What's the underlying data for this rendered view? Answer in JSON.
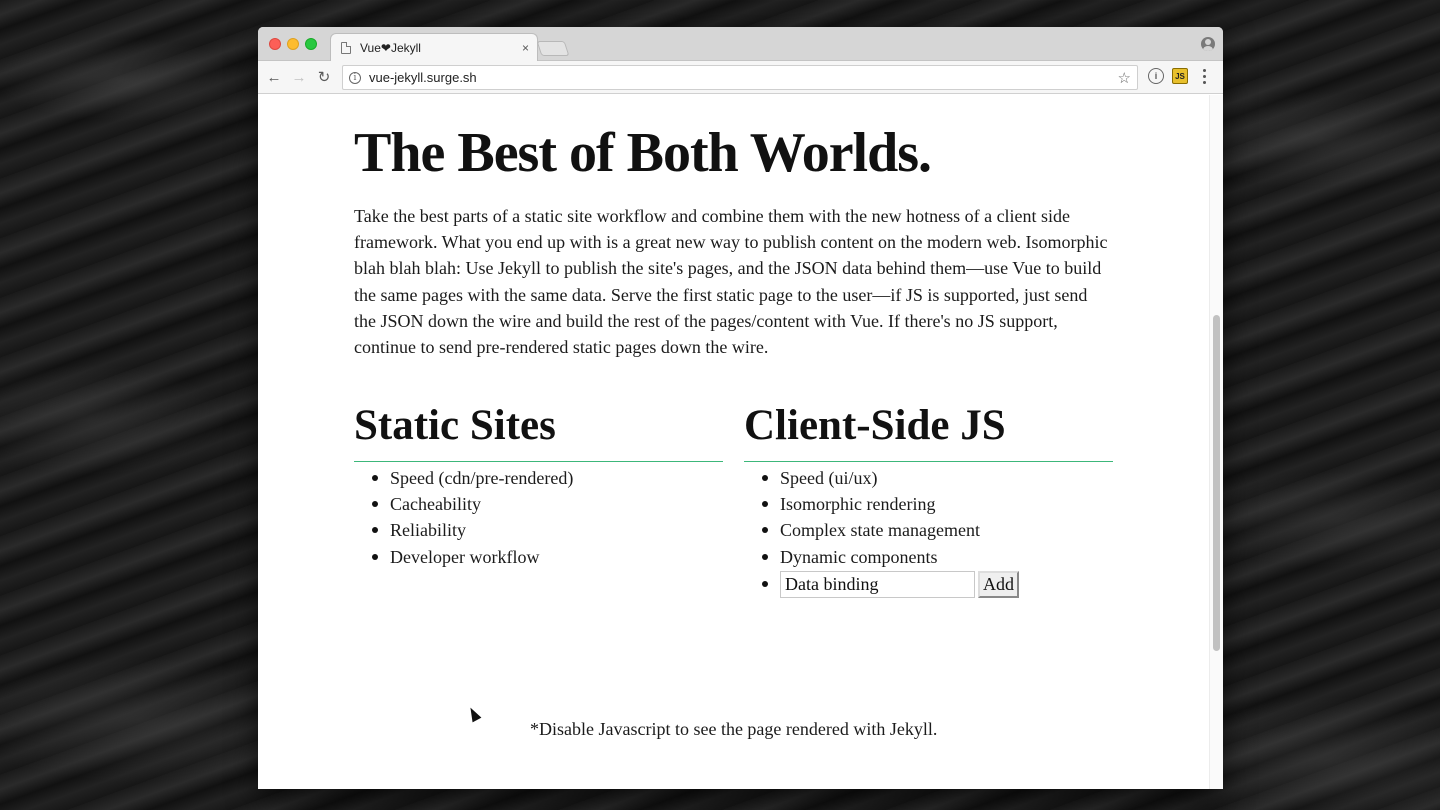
{
  "browser": {
    "tab_title": "Vue❤Jekyll",
    "tab_close": "×",
    "url": "vue-jekyll.surge.sh",
    "back_glyph": "←",
    "forward_glyph": "→",
    "reload_glyph": "↻",
    "info_glyph": "i",
    "star_glyph": "☆",
    "extension_1_glyph": "i",
    "extension_2_glyph": "JS"
  },
  "page": {
    "title": "The Best of Both Worlds.",
    "intro": "Take the best parts of a static site workflow and combine them with the new hotness of a client side framework. What you end up with is a great new way to publish content on the modern web. Isomorphic blah blah blah: Use Jekyll to publish the site's pages, and the JSON data behind them—use Vue to build the same pages with the same data. Serve the first static page to the user—if JS is supported, just send the JSON down the wire and build the rest of the pages/content with Vue. If there's no JS support, continue to send pre-rendered static pages down the wire.",
    "static_sites": {
      "title": "Static Sites",
      "items": [
        "Speed (cdn/pre-rendered)",
        "Cacheability",
        "Reliability",
        "Developer workflow"
      ]
    },
    "client_side": {
      "title": "Client-Side JS",
      "items": [
        "Speed (ui/ux)",
        "Isomorphic rendering",
        "Complex state management",
        "Dynamic components"
      ],
      "input_value": "Data binding",
      "add_label": "Add"
    },
    "footnote": "*Disable Javascript to see the page rendered with Jekyll."
  },
  "colors": {
    "accent_rule": "#3cb77a",
    "close_light": "#fc5f57",
    "minimize_light": "#fdbc2e",
    "zoom_light": "#28c840"
  }
}
